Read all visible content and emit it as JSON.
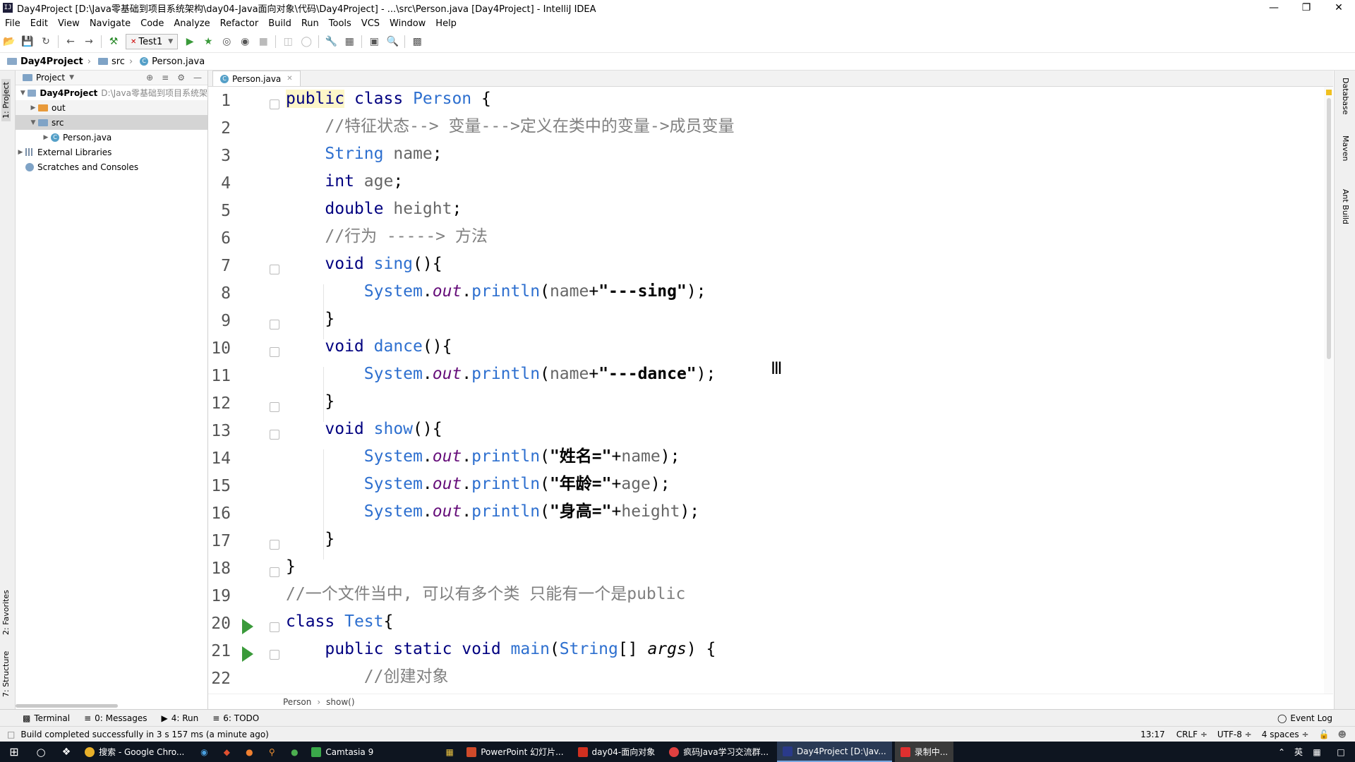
{
  "window": {
    "title": "Day4Project [D:\\Java零基础到项目系统架构\\day04-Java面向对象\\代码\\Day4Project] - ...\\src\\Person.java [Day4Project] - IntelliJ IDEA",
    "app_icon": "IJ",
    "controls": [
      "—",
      "❐",
      "✕"
    ]
  },
  "menu": [
    "File",
    "Edit",
    "View",
    "Navigate",
    "Code",
    "Analyze",
    "Refactor",
    "Build",
    "Run",
    "Tools",
    "VCS",
    "Window",
    "Help"
  ],
  "toolbar": {
    "run_config": "Test1"
  },
  "navbar": {
    "project": "Day4Project",
    "folder": "src",
    "file": "Person.java"
  },
  "left_tools": {
    "project": "1: Project",
    "favorites": "2: Favorites",
    "structure": "7: Structure"
  },
  "right_tools": [
    "Database",
    "Maven",
    "Ant Build"
  ],
  "project_panel": {
    "header": "Project",
    "tree": [
      {
        "label": "Day4Project",
        "path": "D:\\Java零基础到项目系统架",
        "expanded": true,
        "level": 0
      },
      {
        "label": "out",
        "expanded": false,
        "level": 1
      },
      {
        "label": "src",
        "expanded": true,
        "level": 1
      },
      {
        "label": "Person.java",
        "level": 2
      },
      {
        "label": "External Libraries",
        "expanded": false,
        "level": 0
      },
      {
        "label": "Scratches and Consoles",
        "level": 0
      }
    ]
  },
  "editor": {
    "tab": "Person.java",
    "line_numbers": [
      "1",
      "2",
      "3",
      "4",
      "5",
      "6",
      "7",
      "8",
      "9",
      "10",
      "11",
      "12",
      "13",
      "14",
      "15",
      "16",
      "17",
      "18",
      "19",
      "20",
      "21",
      "22"
    ],
    "code": [
      "public class Person {",
      "    //特征状态--> 变量--->定义在类中的变量->成员变量",
      "    String name;",
      "    int age;",
      "    double height;",
      "    //行为 -----> 方法",
      "    void sing(){",
      "        System.out.println(name+\"---sing\");",
      "    }",
      "    void dance(){",
      "        System.out.println(name+\"---dance\");",
      "    }",
      "    void show(){",
      "        System.out.println(\"姓名=\"+name);",
      "        System.out.println(\"年龄=\"+age);",
      "        System.out.println(\"身高=\"+height);",
      "    }",
      "}",
      "//一个文件当中, 可以有多个类 只能有一个是public",
      "class Test{",
      "    public static void main(String[] args) {",
      "        //创建对象"
    ],
    "breadcrumb": [
      "Person",
      "show()"
    ]
  },
  "bottom_tools": [
    "Terminal",
    "0: Messages",
    "4: Run",
    "6: TODO",
    "Event Log"
  ],
  "status": {
    "message": "Build completed successfully in 3 s 157 ms (a minute ago)",
    "position": "13:17",
    "line_sep": "CRLF ÷",
    "encoding": "UTF-8 ÷",
    "indent": "4 spaces ÷"
  },
  "taskbar": {
    "items": [
      "搜索 - Google Chro...",
      "Camtasia 9",
      "PowerPoint 幻灯片...",
      "day04-面向对象",
      "疯码Java学习交流群...",
      "Day4Project [D:\\Jav...",
      "录制中..."
    ],
    "tray_lang": "英"
  },
  "colors": {
    "keyword": "#000080",
    "type": "#2d6fcf",
    "comment": "#808080",
    "static_field": "#660e7a",
    "run_marker": "#3a9a3a"
  }
}
